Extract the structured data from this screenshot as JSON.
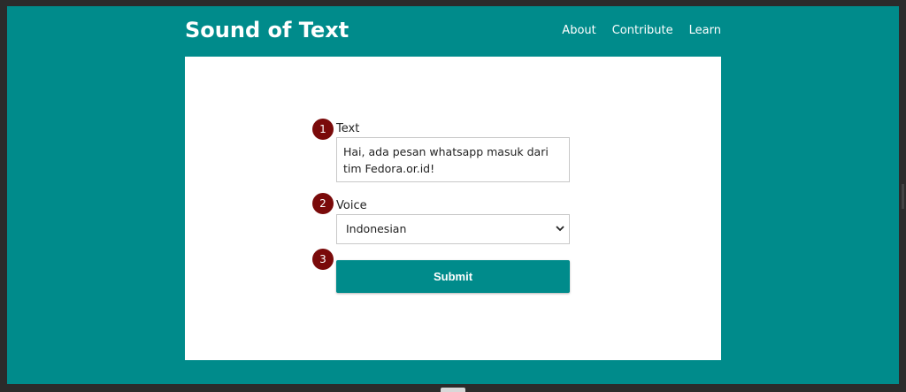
{
  "header": {
    "brand": "Sound of Text",
    "nav": [
      "About",
      "Contribute",
      "Learn"
    ]
  },
  "form": {
    "steps": [
      "1",
      "2",
      "3"
    ],
    "text_label": "Text",
    "text_value": "Hai, ada pesan whatsapp masuk dari tim Fedora.or.id!",
    "voice_label": "Voice",
    "voice_selected": "Indonesian",
    "submit_label": "Submit"
  },
  "colors": {
    "background": "#008b8b",
    "card": "#ffffff",
    "step_badge": "#7a0a0a"
  },
  "icons": {
    "select_arrow": "chevron-down-icon"
  }
}
